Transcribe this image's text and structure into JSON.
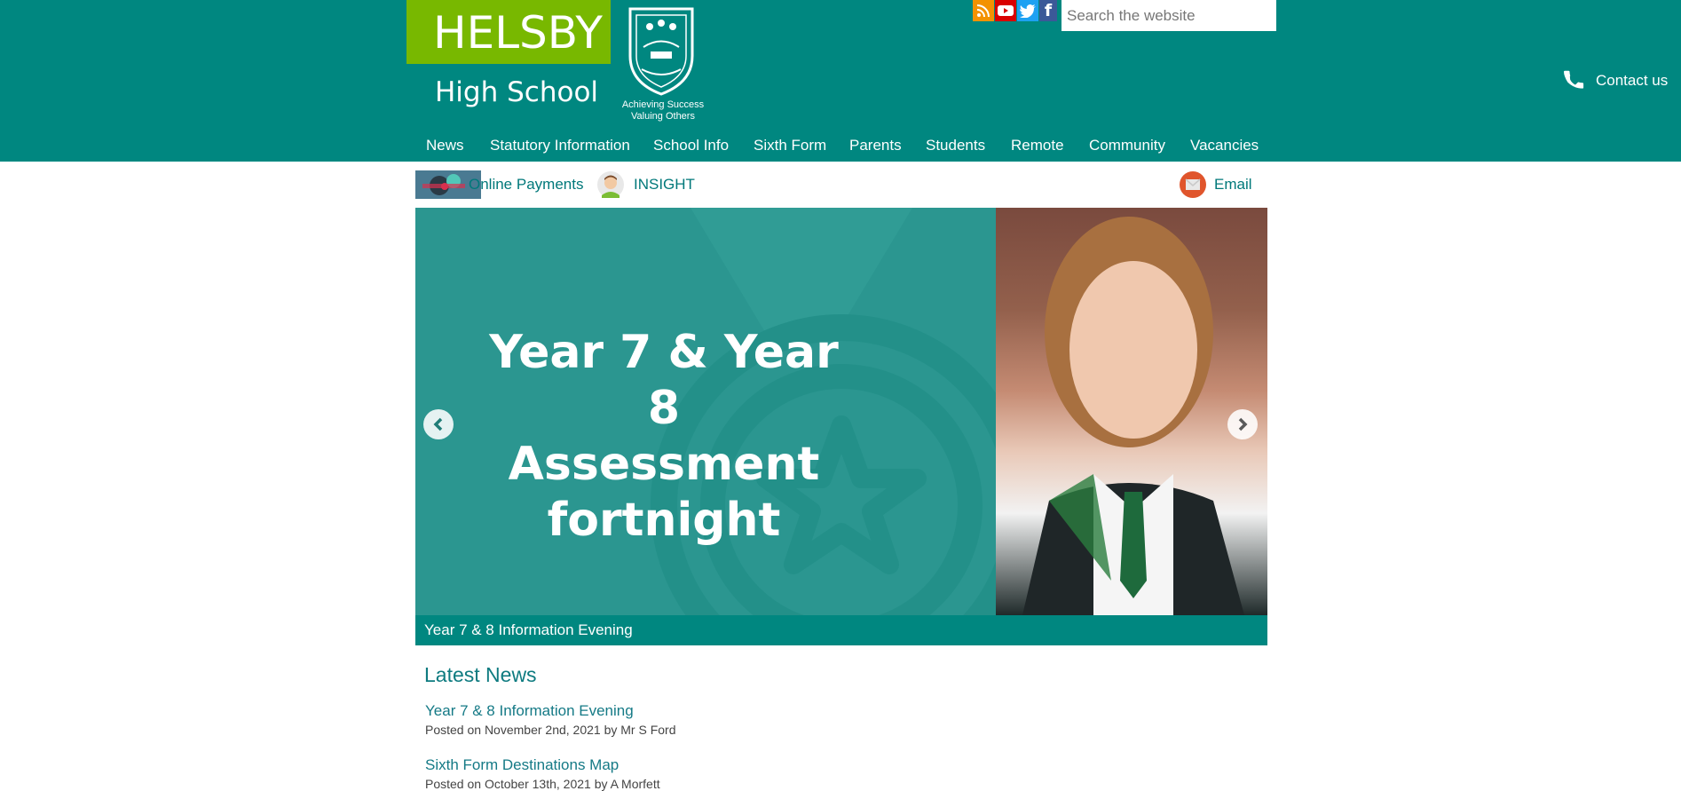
{
  "header": {
    "logo_top": "HELSBY",
    "logo_bottom": "High School",
    "motto_line1": "Achieving Success",
    "motto_line2": "Valuing Others",
    "crest_icon": "school-crest-icon",
    "search_placeholder": "Search the website",
    "contact_label": "Contact us",
    "social": [
      {
        "name": "rss-icon",
        "color": "#f39200"
      },
      {
        "name": "youtube-icon",
        "color": "#d90000"
      },
      {
        "name": "twitter-icon",
        "color": "#1da1f2"
      },
      {
        "name": "facebook-icon",
        "color": "#3b5998"
      }
    ],
    "colors": {
      "teal": "#008780",
      "green": "#78b800"
    }
  },
  "nav": [
    "News",
    "Statutory Information",
    "School Info",
    "Sixth Form",
    "Parents",
    "Students",
    "Remote",
    "Community",
    "Vacancies"
  ],
  "quick_links": {
    "payments": "Online Payments",
    "insight": "INSIGHT",
    "email": "Email"
  },
  "slider": {
    "title_line1": "Year 7 & Year 8",
    "title_line2": "Assessment",
    "title_line3": "fortnight",
    "caption": "Year 7 & 8 Information Evening"
  },
  "news": {
    "heading": "Latest News",
    "items": [
      {
        "title": "Year 7 & 8 Information Evening",
        "meta": "Posted on November 2nd, 2021 by Mr S Ford"
      },
      {
        "title": "Sixth Form Destinations Map",
        "meta": "Posted on October 13th, 2021 by A Morfett"
      }
    ]
  }
}
